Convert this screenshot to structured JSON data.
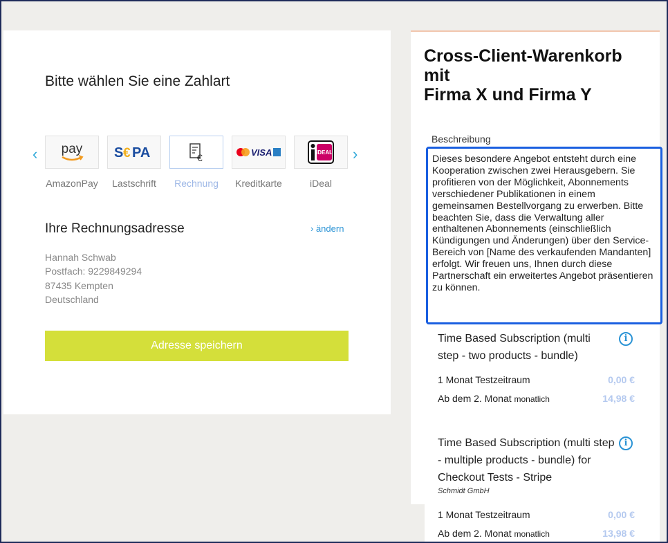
{
  "payment": {
    "title": "Bitte wählen Sie eine Zahlart",
    "prev_arrow": "‹",
    "next_arrow": "›",
    "methods": [
      {
        "label": "AmazonPay",
        "logo_text": "pay",
        "icon": "amazonpay-icon"
      },
      {
        "label": "Lastschrift",
        "logo_text": "SEPA",
        "icon": "sepa-icon"
      },
      {
        "label": "Rechnung",
        "logo_text": "€",
        "icon": "invoice-icon",
        "selected": true
      },
      {
        "label": "Kreditkarte",
        "logo_text": "VISA",
        "icon": "creditcard-icon"
      },
      {
        "label": "iDeal",
        "logo_text": "iDEAL",
        "icon": "ideal-icon"
      }
    ]
  },
  "address": {
    "title": "Ihre Rechnungsadresse",
    "edit_link": "› ändern",
    "lines": [
      "Hannah Schwab",
      "Postfach: 9229849294",
      "87435 Kempten",
      "Deutschland"
    ],
    "save_button": "Adresse speichern"
  },
  "cart": {
    "title_line1": "Cross-Client-Warenkorb",
    "title_line2": "mit",
    "title_line3": "Firma X und Firma Y",
    "description_label": "Beschreibung",
    "description": "Dieses besondere Angebot entsteht durch eine Kooperation zwischen zwei Herausgebern. Sie profitieren von der Möglichkeit, Abonnements verschiedener Publikationen in einem gemeinsamen Bestellvorgang zu erwerben. Bitte beachten Sie, dass die Verwaltung aller enthaltenen Abonnements (einschließlich Kündigungen und Änderungen) über den Service-Bereich von [Name des verkaufenden Mandanten] erfolgt. Wir freuen uns, Ihnen durch diese Partnerschaft ein erweitertes Angebot präsentieren zu können.",
    "products": [
      {
        "title": "Time Based Subscription (multi step - two products - bundle)",
        "vendor": "",
        "rows": [
          {
            "label": "1 Monat Testzeitraum",
            "suffix": "",
            "price": "0,00 €"
          },
          {
            "label": "Ab dem 2. Monat",
            "suffix": "monatlich",
            "price": "14,98 €"
          }
        ]
      },
      {
        "title": "Time Based Subscription (multi step - multiple products - bundle) for Checkout Tests - Stripe",
        "vendor": "Schmidt GmbH",
        "rows": [
          {
            "label": "1 Monat Testzeitraum",
            "suffix": "",
            "price": "0,00 €"
          },
          {
            "label": "Ab dem 2. Monat",
            "suffix": "monatlich",
            "price": "13,98 €"
          }
        ]
      }
    ],
    "info_icon": "i"
  },
  "colors": {
    "accent": "#2a93d5",
    "save_button_bg": "#d4df3a",
    "highlight_border": "#1a5fe0",
    "price": "#b4c9ef"
  }
}
